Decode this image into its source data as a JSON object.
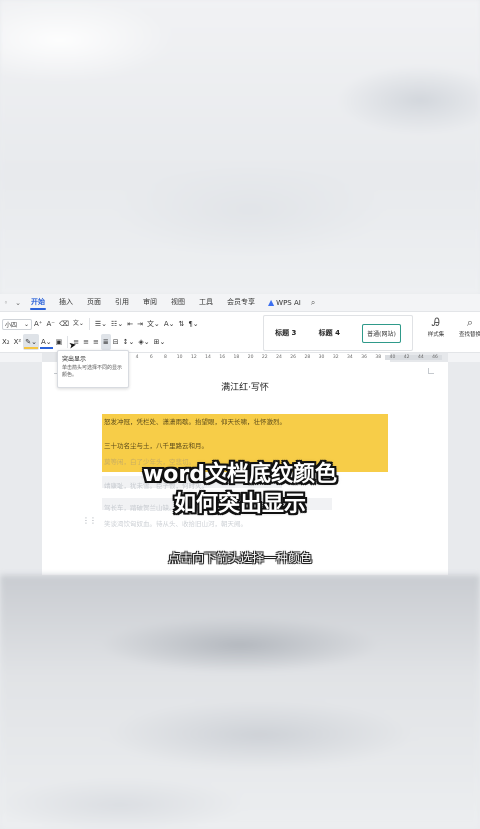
{
  "tabbar": {
    "tabs": [
      {
        "label": "开始",
        "active": true
      },
      {
        "label": "插入"
      },
      {
        "label": "页面"
      },
      {
        "label": "引用"
      },
      {
        "label": "审阅"
      },
      {
        "label": "视图"
      },
      {
        "label": "工具"
      },
      {
        "label": "会员专享"
      }
    ],
    "wps_ai_label": "WPS AI"
  },
  "ribbon": {
    "font_size_value": "小四",
    "styles": {
      "heading3": "标题 3",
      "heading4": "标题 4",
      "normal": "普通(网站)"
    },
    "style_set_label": "样式集",
    "find_replace_label": "查找替换"
  },
  "tooltip": {
    "title": "突出显示",
    "body": "单击箭头可选择不同的显示颜色。"
  },
  "ruler": {
    "ticks": [
      "4",
      "6",
      "8",
      "10",
      "12",
      "14",
      "16",
      "18",
      "20",
      "22",
      "24",
      "26",
      "28",
      "30",
      "32",
      "34",
      "36",
      "38",
      "40",
      "42",
      "44",
      "46"
    ]
  },
  "document": {
    "title": "满江红·写怀",
    "lines": [
      "怒发冲冠，凭栏处、潇潇雨歇。抬望眼，仰天长啸，壮怀激烈。",
      "三十功名尘与土，八千里路云和月。",
      "莫等闲，白了少年头，空悲切。",
      "靖康耻，犹未雪。臣子恨，何时灭。",
      "驾长车，踏破贺兰山缺。壮志饥餐胡虏肉，",
      "笑谈渴饮匈奴血。待从头、收拾旧山河，朝天阙。"
    ]
  },
  "overlay": {
    "title_line1": "word文档底纹颜色",
    "title_line2": "如何突出显示",
    "subtitle": "点击向下箭头选择一种颜色"
  },
  "colors": {
    "accent": "#2b62d9",
    "highlight": "#f7cd48"
  }
}
